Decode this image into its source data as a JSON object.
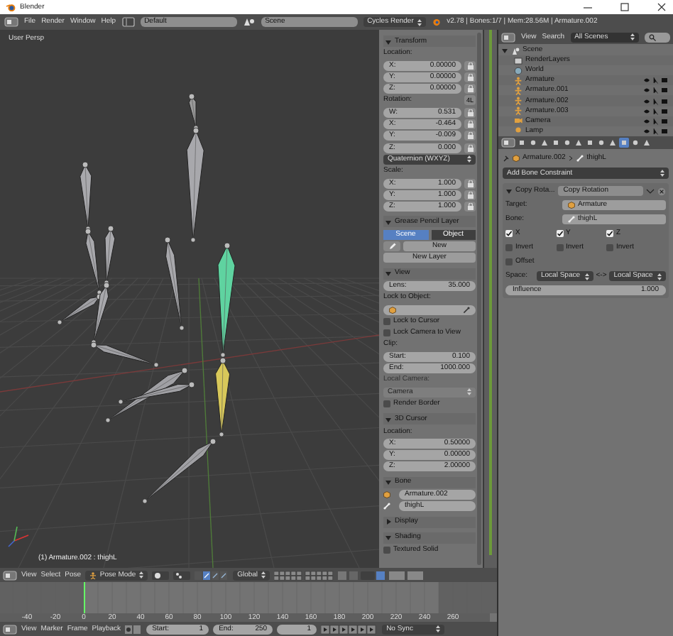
{
  "window": {
    "title": "Blender"
  },
  "menubar": {
    "menus": [
      "File",
      "Render",
      "Window",
      "Help"
    ],
    "screen_layout": "Default",
    "scene": "Scene",
    "render_engine": "Cycles Render",
    "info": "v2.78 | Bones:1/7 | Mem:28.56M | Armature.002"
  },
  "viewport": {
    "view_label": "User Persp",
    "status": "(1) Armature.002 : thighL"
  },
  "properties_panel": {
    "sections": [
      {
        "title": "Transform",
        "expanded": true,
        "rows": [
          {
            "kind": "label",
            "text": "Location:"
          },
          {
            "kind": "number",
            "label": "X:",
            "value": "0.00000",
            "lock": true
          },
          {
            "kind": "number",
            "label": "Y:",
            "value": "0.00000",
            "lock": true
          },
          {
            "kind": "number",
            "label": "Z:",
            "value": "0.00000",
            "lock": true
          },
          {
            "kind": "label",
            "text": "Rotation:",
            "toggle": "4L"
          },
          {
            "kind": "number",
            "label": "W:",
            "value": "0.531",
            "lock": true
          },
          {
            "kind": "number",
            "label": "X:",
            "value": "-0.464",
            "lock": true
          },
          {
            "kind": "number",
            "label": "Y:",
            "value": "-0.009",
            "lock": true
          },
          {
            "kind": "number",
            "label": "Z:",
            "value": "0.000",
            "lock": true
          },
          {
            "kind": "dropdown",
            "value": "Quaternion (WXYZ)"
          },
          {
            "kind": "label",
            "text": "Scale:"
          },
          {
            "kind": "number",
            "label": "X:",
            "value": "1.000",
            "lock": true
          },
          {
            "kind": "number",
            "label": "Y:",
            "value": "1.000",
            "lock": true
          },
          {
            "kind": "number",
            "label": "Z:",
            "value": "1.000",
            "lock": true
          }
        ]
      },
      {
        "title": "Grease Pencil Layer",
        "expanded": true,
        "rows": [
          {
            "kind": "tabs",
            "tabs": [
              {
                "label": "Scene",
                "selected": true
              },
              {
                "label": "Object",
                "selected": false
              }
            ]
          },
          {
            "kind": "new",
            "label": "New"
          },
          {
            "kind": "button",
            "label": "New Layer"
          }
        ]
      },
      {
        "title": "View",
        "expanded": true,
        "rows": [
          {
            "kind": "number",
            "label": "Lens:",
            "value": "35.000"
          },
          {
            "kind": "label",
            "text": "Lock to Object:"
          },
          {
            "kind": "object-field"
          },
          {
            "kind": "checkbox",
            "label": "Lock to Cursor",
            "checked": false
          },
          {
            "kind": "checkbox",
            "label": "Lock Camera to View",
            "checked": false
          },
          {
            "kind": "label",
            "text": "Clip:"
          },
          {
            "kind": "number",
            "label": "Start:",
            "value": "0.100"
          },
          {
            "kind": "number",
            "label": "End:",
            "value": "1000.000"
          },
          {
            "kind": "label",
            "text": "Local Camera:",
            "disabled": true
          },
          {
            "kind": "dropdown",
            "value": "Camera",
            "disabled": true
          },
          {
            "kind": "checkbox",
            "label": "Render Border",
            "checked": false
          }
        ]
      },
      {
        "title": "3D Cursor",
        "expanded": true,
        "rows": [
          {
            "kind": "label",
            "text": "Location:"
          },
          {
            "kind": "number",
            "label": "X:",
            "value": "0.50000"
          },
          {
            "kind": "number",
            "label": "Y:",
            "value": "0.00000"
          },
          {
            "kind": "number",
            "label": "Z:",
            "value": "2.00000"
          }
        ]
      },
      {
        "title": "Bone",
        "expanded": true,
        "rows": [
          {
            "kind": "object-name",
            "value": "Armature.002"
          },
          {
            "kind": "bone-name",
            "value": "thighL"
          }
        ]
      },
      {
        "title": "Display",
        "expanded": false
      },
      {
        "title": "Shading",
        "expanded": true,
        "rows": [
          {
            "kind": "checkbox",
            "label": "Textured Solid",
            "checked": false
          }
        ]
      }
    ]
  },
  "outliner": {
    "menus": [
      "View",
      "Search"
    ],
    "filter": "All Scenes",
    "tree": [
      {
        "name": "Scene",
        "kind": "scene",
        "expanded": true,
        "children": [
          {
            "name": "RenderLayers",
            "kind": "renderlayers"
          },
          {
            "name": "World",
            "kind": "world"
          },
          {
            "name": "Armature",
            "kind": "armature"
          },
          {
            "name": "Armature.001",
            "kind": "armature"
          },
          {
            "name": "Armature.002",
            "kind": "armature"
          },
          {
            "name": "Armature.003",
            "kind": "armature"
          },
          {
            "name": "Camera",
            "kind": "camera"
          },
          {
            "name": "Lamp",
            "kind": "lamp"
          }
        ]
      }
    ]
  },
  "properties_editor": {
    "tabs": [
      {
        "selected": false
      },
      {
        "selected": false
      },
      {
        "selected": false
      },
      {
        "selected": false
      },
      {
        "selected": false
      },
      {
        "selected": false
      },
      {
        "selected": false
      },
      {
        "selected": false
      },
      {
        "selected": false
      },
      {
        "selected": true
      },
      {
        "selected": false
      },
      {
        "selected": false
      }
    ],
    "breadcrumb": [
      "Armature.002",
      "thighL"
    ],
    "add_constraint": "Add Bone Constraint",
    "constraint": {
      "type_label": "Copy Rota...",
      "name": "Copy Rotation",
      "expanded": true,
      "target": {
        "label": "Target:",
        "value": "Armature"
      },
      "bone": {
        "label": "Bone:",
        "value": "thighL"
      },
      "axes": [
        {
          "label": "X",
          "checked": true
        },
        {
          "label": "Y",
          "checked": true
        },
        {
          "label": "Z",
          "checked": true
        }
      ],
      "inverts": [
        {
          "label": "Invert",
          "checked": false
        },
        {
          "label": "Invert",
          "checked": false
        },
        {
          "label": "Invert",
          "checked": false
        }
      ],
      "offset": {
        "label": "Offset",
        "checked": false
      },
      "space": {
        "label": "Space:",
        "owner": "Local Space",
        "arrow": "<->",
        "target": "Local Space"
      },
      "influence": {
        "label": "Influence",
        "value": "1.000",
        "level": 1
      }
    }
  },
  "viewport_header": {
    "menus": [
      "View",
      "Select",
      "Pose"
    ],
    "mode": "Pose Mode",
    "orientation": "Global"
  },
  "timeline": {
    "ticks": [
      "-40",
      "-20",
      "0",
      "20",
      "40",
      "60",
      "80",
      "100",
      "120",
      "140",
      "160",
      "180",
      "200",
      "220",
      "240",
      "260"
    ],
    "menus": [
      "View",
      "Marker",
      "Frame",
      "Playback"
    ],
    "start": {
      "label": "Start:",
      "value": "1"
    },
    "end": {
      "label": "End:",
      "value": "250"
    },
    "current": "1",
    "sync": "No Sync"
  }
}
